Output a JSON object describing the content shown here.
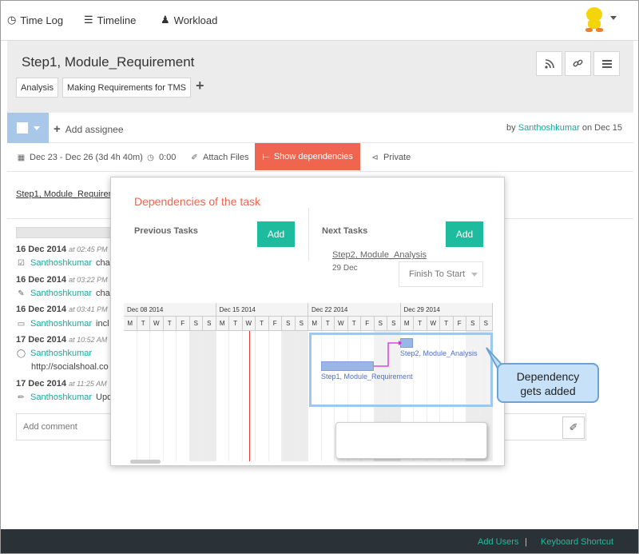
{
  "nav": {
    "timelog": "Time Log",
    "timeline": "Timeline",
    "workload": "Workload"
  },
  "task": {
    "title": "Step1, Module_Requirement",
    "tags": [
      "Analysis",
      "Making Requirements for TMS"
    ],
    "add_tag": "+"
  },
  "assignee": {
    "add_label": "Add assignee",
    "by": "by",
    "user": "Santhoshkumar",
    "date": "on Dec 15"
  },
  "actions": {
    "date_range": "Dec 23 - Dec 26 (3d 4h 40m)",
    "time": "0:00",
    "attach": "Attach Files",
    "show_dependencies": "Show dependencies",
    "privacy": "Private"
  },
  "breadcrumb_link": "Step1, Module_Requirem",
  "activity": [
    {
      "date": "16 Dec 2014",
      "time": "at 02:45 PM",
      "user": "Santhoshkumar",
      "text": "cha"
    },
    {
      "date": "16 Dec 2014",
      "time": "at 03:22 PM",
      "user": "Santhoshkumar",
      "text": "cha"
    },
    {
      "date": "16 Dec 2014",
      "time": "at 03:41 PM",
      "user": "Santhoshkumar",
      "text": "incl"
    },
    {
      "date": "17 Dec 2014",
      "time": "at 10:52 AM",
      "user": "Santhoshkumar",
      "text": "",
      "extra": "http://socialshoal.co"
    },
    {
      "date": "17 Dec 2014",
      "time": "at 11:25 AM",
      "user": "Santhoshkumar",
      "text": "Upd"
    }
  ],
  "comment": {
    "placeholder": "Add comment"
  },
  "dependencies": {
    "title": "Dependencies of the task",
    "previous_label": "Previous Tasks",
    "next_label": "Next Tasks",
    "add": "Add",
    "next_task_name": "Step2, Module_Analysis",
    "next_task_date": "29 Dec",
    "link_type": "Finish To Start",
    "weeks": [
      "Dec 08 2014",
      "Dec 15 2014",
      "Dec 22 2014",
      "Dec 29 2014"
    ],
    "days": [
      "M",
      "T",
      "W",
      "T",
      "F",
      "S",
      "S"
    ],
    "bar1_label": "Step1, Module_Requirement",
    "bar2_label": "Step2, Module_Analysis"
  },
  "callout": {
    "line1": "Dependency",
    "line2": "gets added"
  },
  "footer": {
    "add_users": "Add Users",
    "separator": "|",
    "shortcut": "Keyboard Shortcut"
  }
}
